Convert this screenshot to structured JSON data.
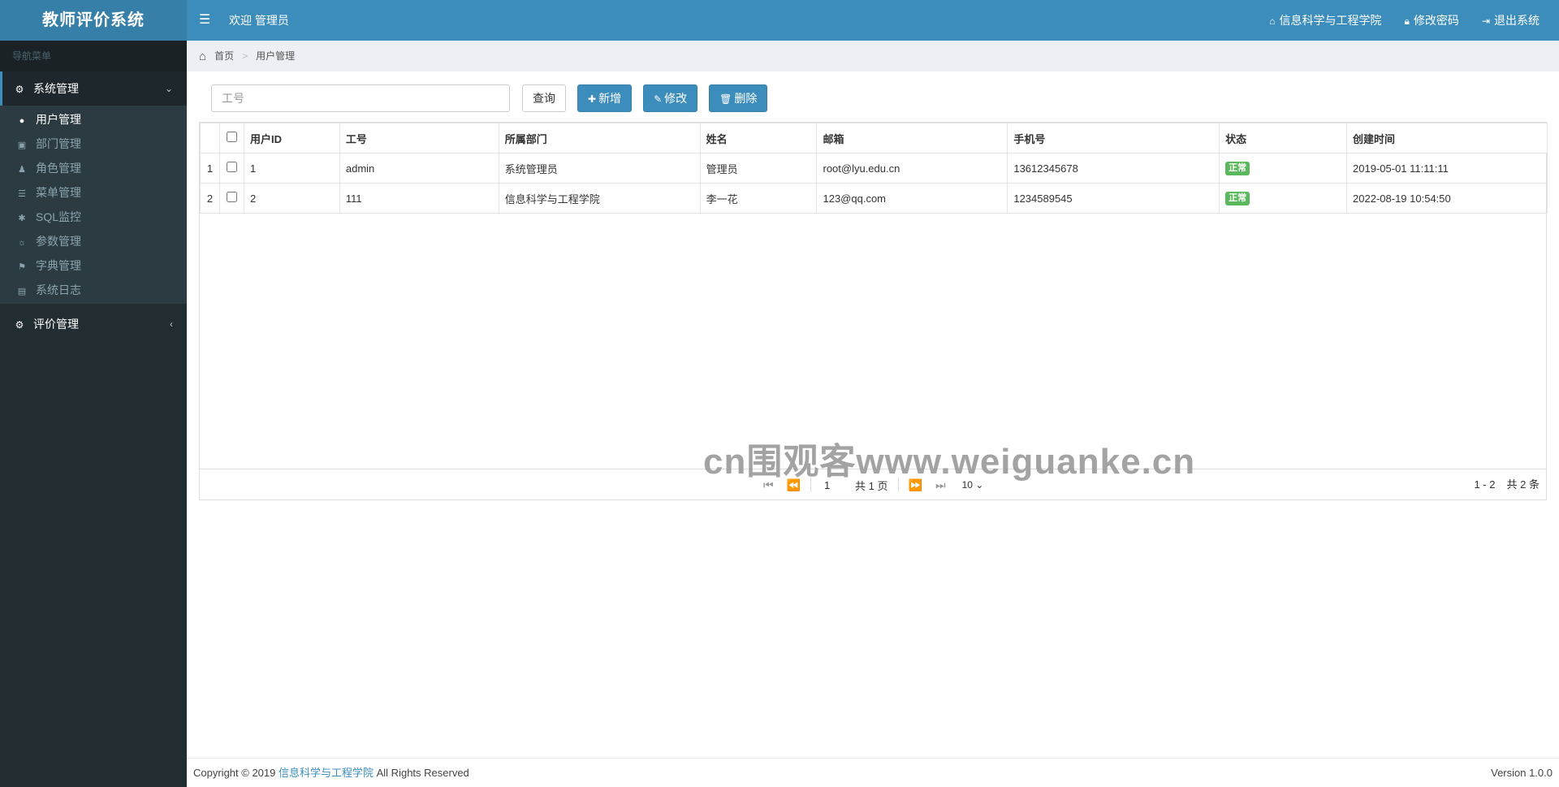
{
  "app": {
    "title": "教师评价系统"
  },
  "header": {
    "welcome": "欢迎 管理员",
    "links": [
      {
        "label": "信息科学与工程学院",
        "icon": "home-icon"
      },
      {
        "label": "修改密码",
        "icon": "lock-icon"
      },
      {
        "label": "退出系统",
        "icon": "sign-out-icon"
      }
    ]
  },
  "sidebar": {
    "header": "导航菜单",
    "groups": [
      {
        "label": "系统管理",
        "icon": "gear-icon",
        "expanded": true,
        "items": [
          {
            "label": "用户管理",
            "icon": "user-icon",
            "active": true
          },
          {
            "label": "部门管理",
            "icon": "department-icon"
          },
          {
            "label": "角色管理",
            "icon": "role-icon"
          },
          {
            "label": "菜单管理",
            "icon": "list-icon"
          },
          {
            "label": "SQL监控",
            "icon": "bug-icon"
          },
          {
            "label": "参数管理",
            "icon": "settings-icon"
          },
          {
            "label": "字典管理",
            "icon": "bookmark-icon"
          },
          {
            "label": "系统日志",
            "icon": "log-icon"
          }
        ]
      },
      {
        "label": "评价管理",
        "icon": "gear-icon",
        "expanded": false
      }
    ]
  },
  "breadcrumb": {
    "home": "首页",
    "current": "用户管理"
  },
  "toolbar": {
    "search_placeholder": "工号",
    "query": "查询",
    "add": "新增",
    "edit": "修改",
    "delete": "删除"
  },
  "table": {
    "columns": [
      "用户ID",
      "工号",
      "所属部门",
      "姓名",
      "邮箱",
      "手机号",
      "状态",
      "创建时间"
    ],
    "rows": [
      {
        "no": "1",
        "id": "1",
        "code": "admin",
        "dept": "系统管理员",
        "name": "管理员",
        "email": "root@lyu.edu.cn",
        "phone": "13612345678",
        "status": "正常",
        "created": "2019-05-01 11:11:11"
      },
      {
        "no": "2",
        "id": "2",
        "code": "111",
        "dept": "信息科学与工程学院",
        "name": "李一花",
        "email": "123@qq.com",
        "phone": "1234589545",
        "status": "正常",
        "created": "2022-08-19 10:54:50"
      }
    ]
  },
  "watermark": "cn围观客www.weiguanke.cn",
  "pager": {
    "page": "1",
    "total_pages": "共 1 页",
    "page_size": "10",
    "range": "1 - 2",
    "total": "共 2 条"
  },
  "footer": {
    "copyright_prefix": "Copyright © 2019",
    "org": "信息科学与工程学院",
    "suffix": "All Rights Reserved",
    "version": "Version 1.0.0"
  },
  "colors": {
    "primary": "#3c8dbc",
    "sidebar": "#222d32",
    "success": "#5cb85c"
  }
}
